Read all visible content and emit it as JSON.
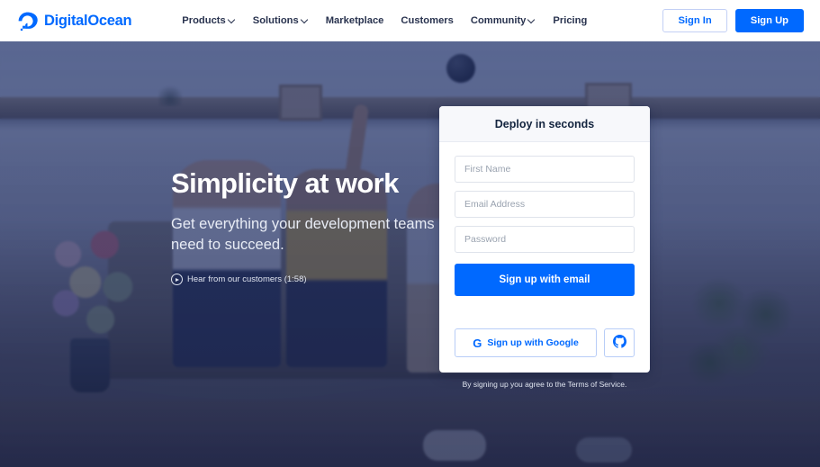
{
  "brand": {
    "name": "DigitalOcean",
    "logo_icon": "digitalocean-logo-icon",
    "accent_color": "#0069ff"
  },
  "nav": {
    "items": [
      {
        "label": "Products",
        "has_dropdown": true
      },
      {
        "label": "Solutions",
        "has_dropdown": true
      },
      {
        "label": "Marketplace",
        "has_dropdown": false
      },
      {
        "label": "Customers",
        "has_dropdown": false
      },
      {
        "label": "Community",
        "has_dropdown": true
      },
      {
        "label": "Pricing",
        "has_dropdown": false
      }
    ],
    "sign_in_label": "Sign In",
    "sign_up_label": "Sign Up"
  },
  "hero": {
    "title": "Simplicity at work",
    "subtitle": "Get everything your development teams need to succeed.",
    "video_label": "Hear from our customers (1:58)",
    "video_icon": "play-circle-icon",
    "overlay_color": "#1f316e"
  },
  "signup_card": {
    "title": "Deploy in seconds",
    "fields": [
      {
        "name": "first-name",
        "placeholder": "First Name",
        "value": ""
      },
      {
        "name": "email",
        "placeholder": "Email Address",
        "value": ""
      },
      {
        "name": "password",
        "placeholder": "Password",
        "value": ""
      }
    ],
    "primary_button": "Sign up with email",
    "google_button": "Sign up with Google",
    "google_icon": "google-g-icon",
    "github_icon": "github-icon",
    "terms_text": "By signing up you agree to the Terms of Service."
  }
}
